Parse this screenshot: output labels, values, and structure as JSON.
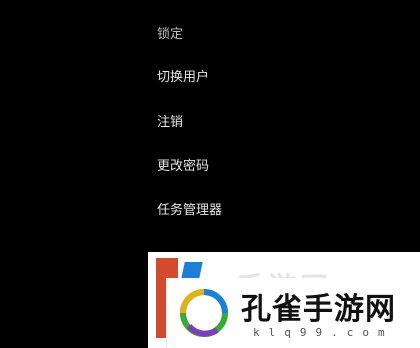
{
  "menu": {
    "items": [
      {
        "label": "锁定"
      },
      {
        "label": "切换用户"
      },
      {
        "label": "注销"
      },
      {
        "label": "更改密码"
      },
      {
        "label": "任务管理器"
      }
    ]
  },
  "watermark": {
    "title": "孔雀手游网",
    "url": "klq99.com",
    "faint_text": "手游网",
    "colors": {
      "red": "#d14b2f",
      "blue": "#1e7fd6",
      "green": "#3aa935",
      "purple": "#7b3fb5"
    }
  }
}
